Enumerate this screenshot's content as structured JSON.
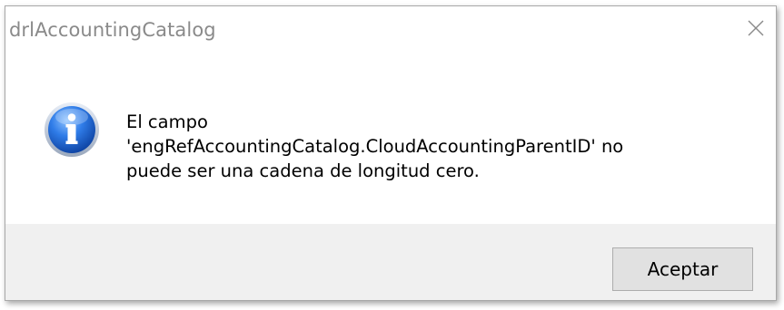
{
  "window": {
    "title": "drlAccountingCatalog",
    "close_icon": "close-icon"
  },
  "dialog": {
    "icon": "info-icon",
    "message": "El campo\n'engRefAccountingCatalog.CloudAccountingParentID' no\npuede ser una cadena de longitud cero."
  },
  "buttons": {
    "ok_label": "Aceptar"
  },
  "colors": {
    "title_text": "#8a8a8a",
    "footer_bg": "#f0f0f0",
    "button_bg": "#e1e1e1",
    "icon_blue": "#1f5fc4"
  }
}
